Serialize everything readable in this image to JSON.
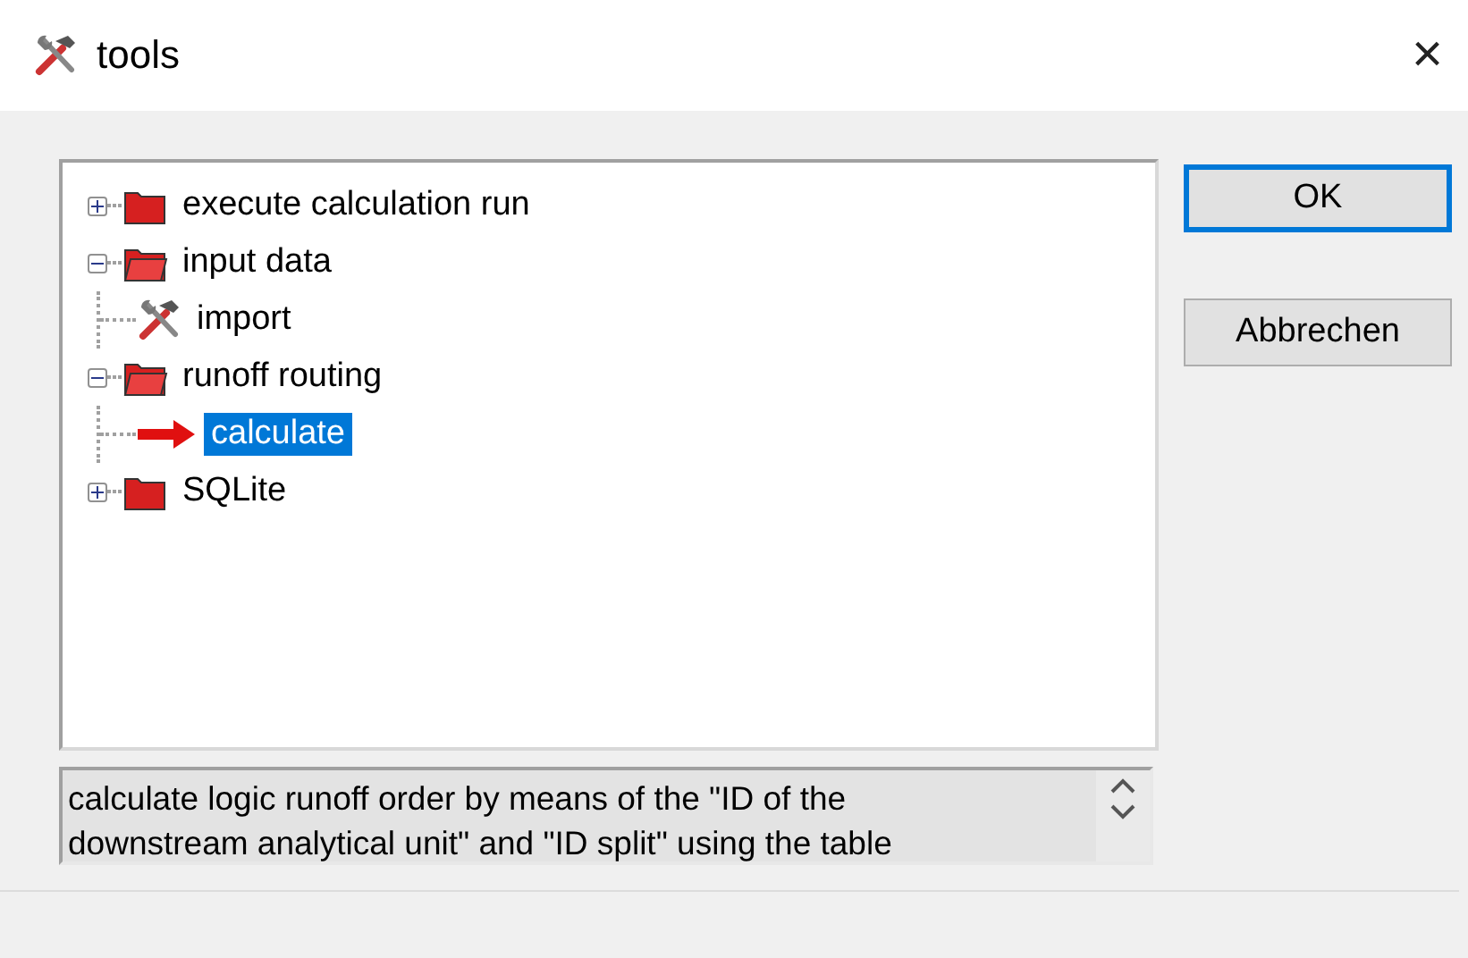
{
  "window": {
    "title": "tools",
    "close": "×"
  },
  "tree": [
    {
      "label": "execute calculation run",
      "kind": "folder",
      "expanded": false,
      "selected": false
    },
    {
      "label": "input data",
      "kind": "folder",
      "expanded": true,
      "selected": false,
      "children": [
        {
          "label": "import",
          "kind": "tool",
          "selected": false
        }
      ]
    },
    {
      "label": "runoff routing",
      "kind": "folder",
      "expanded": true,
      "selected": false,
      "children": [
        {
          "label": "calculate",
          "kind": "arrow",
          "selected": true
        }
      ]
    },
    {
      "label": "SQLite",
      "kind": "folder",
      "expanded": false,
      "selected": false
    }
  ],
  "description": "calculate logic runoff order by means of the \"ID of the downstream analytical unit\" and \"ID split\" using the table",
  "buttons": [
    {
      "label": "OK",
      "default": true
    },
    {
      "label": "Abbrechen",
      "default": false
    }
  ]
}
